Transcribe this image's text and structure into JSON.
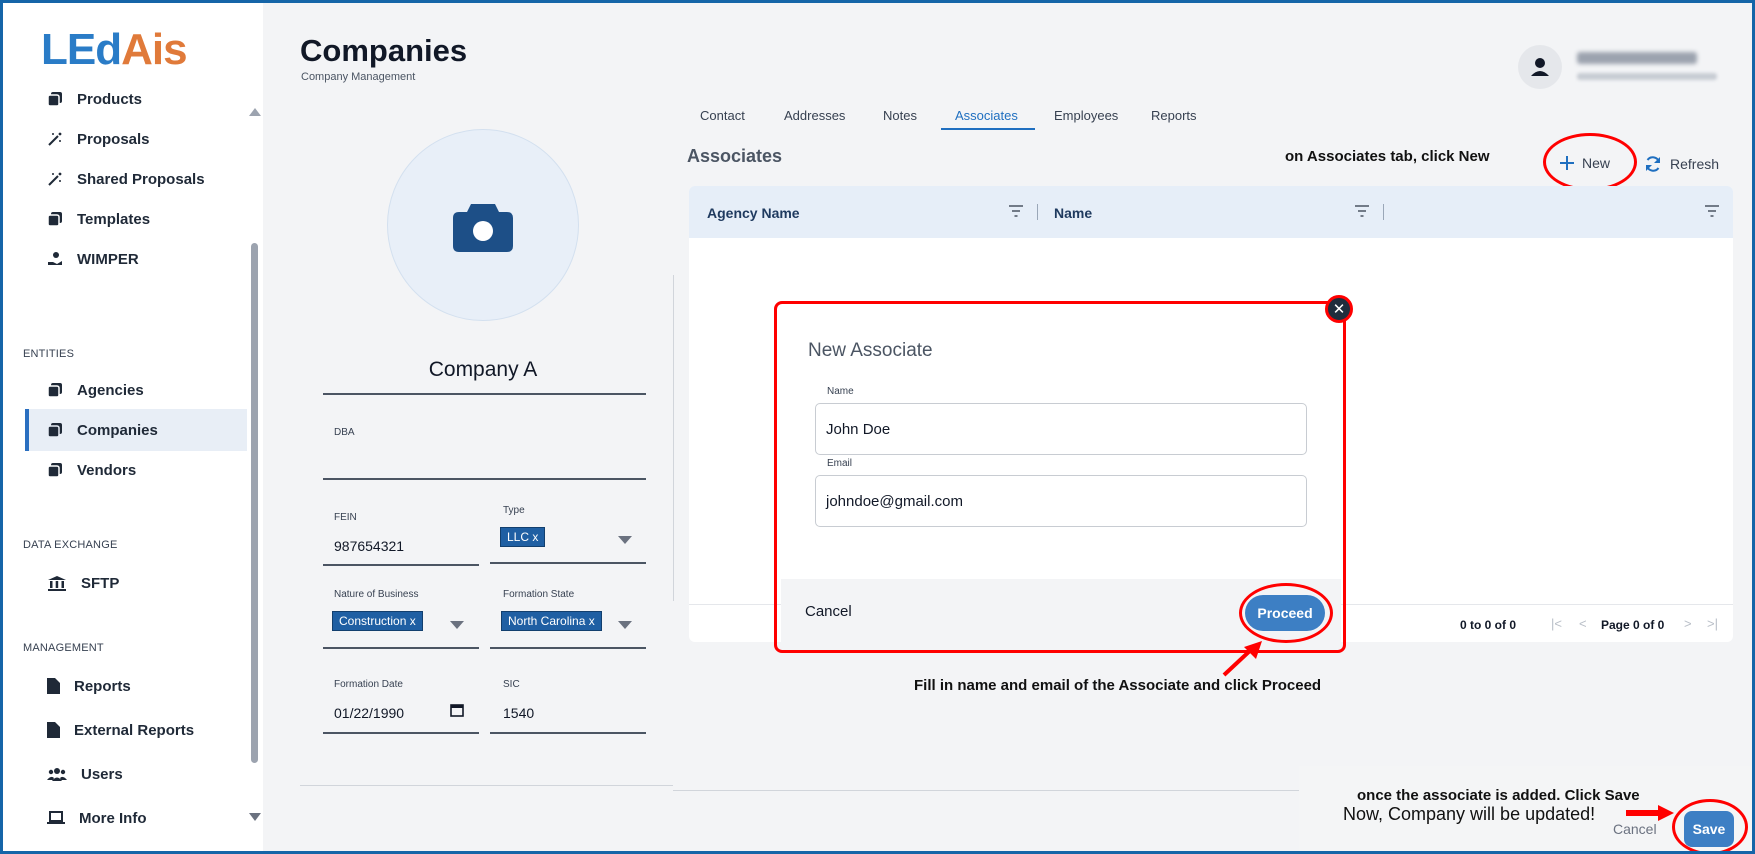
{
  "app": {
    "logo_part1": "LEd",
    "logo_part2": "Ais"
  },
  "sidebar": {
    "items_top": [
      {
        "label": "Products",
        "icon": "stack-icon"
      },
      {
        "label": "Proposals",
        "icon": "magic-wand-icon"
      },
      {
        "label": "Shared Proposals",
        "icon": "magic-wand-icon"
      },
      {
        "label": "Templates",
        "icon": "stack-icon"
      },
      {
        "label": "WIMPER",
        "icon": "hand-coin-icon"
      }
    ],
    "entities_label": "ENTITIES",
    "entities": [
      {
        "label": "Agencies",
        "icon": "stack-icon"
      },
      {
        "label": "Companies",
        "icon": "stack-icon",
        "active": true
      },
      {
        "label": "Vendors",
        "icon": "stack-icon"
      }
    ],
    "data_exchange_label": "DATA EXCHANGE",
    "data_exchange": [
      {
        "label": "SFTP",
        "icon": "bank-icon"
      }
    ],
    "management_label": "MANAGEMENT",
    "management": [
      {
        "label": "Reports",
        "icon": "file-icon"
      },
      {
        "label": "External Reports",
        "icon": "file-icon"
      },
      {
        "label": "Users",
        "icon": "users-icon"
      },
      {
        "label": "More Info",
        "icon": "laptop-icon"
      }
    ]
  },
  "header": {
    "title": "Companies",
    "subtitle": "Company Management"
  },
  "company": {
    "name": "Company A",
    "dba_label": "DBA",
    "dba_value": "",
    "fein_label": "FEIN",
    "fein_value": "987654321",
    "type_label": "Type",
    "type_chip": "LLC",
    "nature_label": "Nature of Business",
    "nature_chip": "Construction",
    "formation_state_label": "Formation State",
    "formation_state_chip": "North Carolina",
    "formation_date_label": "Formation Date",
    "formation_date_value": "01/22/1990",
    "sic_label": "SIC",
    "sic_value": "1540",
    "chip_remove": "x"
  },
  "tabs": [
    "Contact",
    "Addresses",
    "Notes",
    "Associates",
    "Employees",
    "Reports"
  ],
  "active_tab": "Associates",
  "associates": {
    "title": "Associates",
    "new_label": "New",
    "refresh_label": "Refresh",
    "columns": [
      "Agency Name",
      "Name",
      ""
    ],
    "pager_summary": "0 to 0 of 0",
    "pager_page": "Page 0 of 0"
  },
  "modal": {
    "title": "New Associate",
    "close_glyph": "✕",
    "name_label": "Name",
    "name_value": "John Doe",
    "email_label": "Email",
    "email_value": "johndoe@gmail.com",
    "cancel_label": "Cancel",
    "proceed_label": "Proceed"
  },
  "annotations": {
    "new_hint": "on Associates tab, click New",
    "proceed_hint": "Fill in name and email of the Associate and click Proceed",
    "save_hint_1": "once the associate is added. Click Save",
    "save_hint_2": "Now, Company will be updated!"
  },
  "footer": {
    "cancel_label": "Cancel",
    "save_label": "Save"
  },
  "colors": {
    "accent": "#1f6fc0",
    "annotation_red": "#ff0000",
    "chip": "#1f5fa3"
  }
}
